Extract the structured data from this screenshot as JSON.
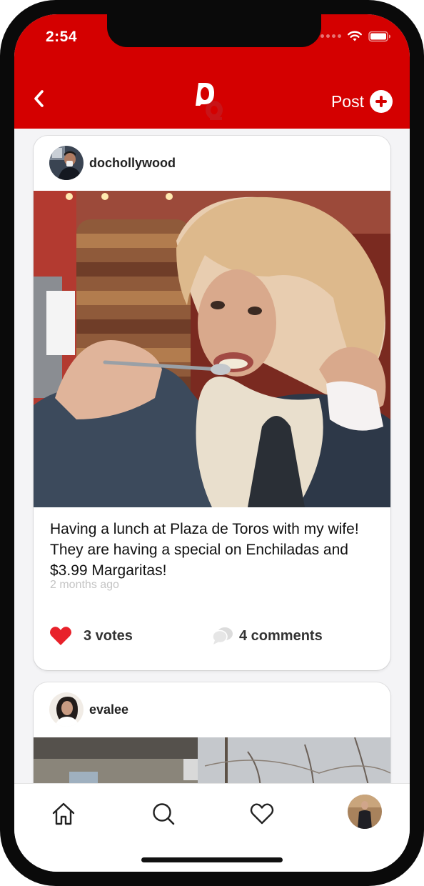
{
  "status_bar": {
    "time": "2:54",
    "icons": [
      "signal-dots-icon",
      "wifi-icon",
      "battery-icon"
    ]
  },
  "header": {
    "back_icon": "chevron-left-icon",
    "logo_icon": "app-logo-icon",
    "post_label": "Post",
    "post_icon": "plus-circle-icon",
    "background_color": "#d40000"
  },
  "feed": {
    "posts": [
      {
        "username": "dochollywood",
        "caption": "Having a lunch at Plaza de Toros with my wife! They are having a special on Enchiladas and $3.99 Margaritas!",
        "timestamp": "2 months ago",
        "votes_label": "3 votes",
        "comments_label": "4 comments",
        "vote_icon": "heart-filled-icon",
        "comment_icon": "speech-bubbles-icon"
      },
      {
        "username": "evalee"
      }
    ]
  },
  "tab_bar": {
    "tabs": [
      {
        "name": "home",
        "icon": "home-icon"
      },
      {
        "name": "search",
        "icon": "search-icon"
      },
      {
        "name": "likes",
        "icon": "heart-outline-icon"
      },
      {
        "name": "profile",
        "icon": "profile-avatar"
      }
    ]
  },
  "colors": {
    "accent": "#d40000",
    "vote_heart": "#e8212a",
    "muted_text": "#c4c4c4"
  }
}
